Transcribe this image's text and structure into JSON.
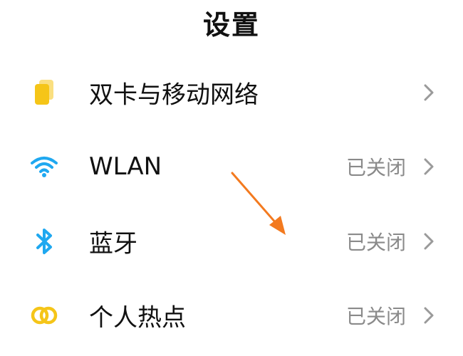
{
  "header": {
    "title": "设置"
  },
  "items": [
    {
      "label": "双卡与移动网络",
      "status": "",
      "icon": "sim-card-icon",
      "icon_color": "#F5C518"
    },
    {
      "label": "WLAN",
      "status": "已关闭",
      "icon": "wifi-icon",
      "icon_color": "#1FA8F0"
    },
    {
      "label": "蓝牙",
      "status": "已关闭",
      "icon": "bluetooth-icon",
      "icon_color": "#1FA8F0"
    },
    {
      "label": "个人热点",
      "status": "已关闭",
      "icon": "hotspot-icon",
      "icon_color": "#F5C518"
    }
  ],
  "annotation": {
    "arrow_color": "#F37A1F"
  }
}
